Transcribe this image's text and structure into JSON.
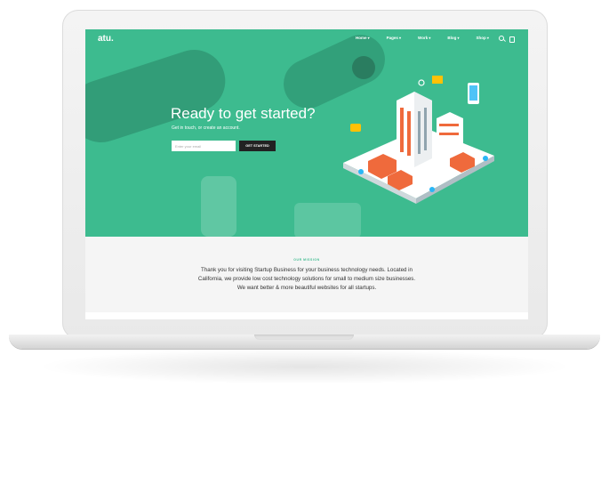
{
  "header": {
    "logo": "atu.",
    "nav": [
      "Home",
      "Pages",
      "Work",
      "Blog",
      "Shop"
    ],
    "icons": [
      "search-icon",
      "cart-icon"
    ]
  },
  "hero": {
    "title": "Ready to get started?",
    "subtitle": "Get in touch, or create an account.",
    "email_placeholder": "Enter your email",
    "cta_label": "GET STARTED"
  },
  "mission": {
    "eyebrow": "OUR MISSION",
    "text": "Thank you for visiting Startup Business for your business technology needs. Located in California, we provide low cost technology solutions for small to medium size businesses. We want better & more beautiful websites for all startups."
  },
  "colors": {
    "accent": "#3dbb8f",
    "button": "#222222",
    "illustration_orange": "#ef6a3c"
  }
}
